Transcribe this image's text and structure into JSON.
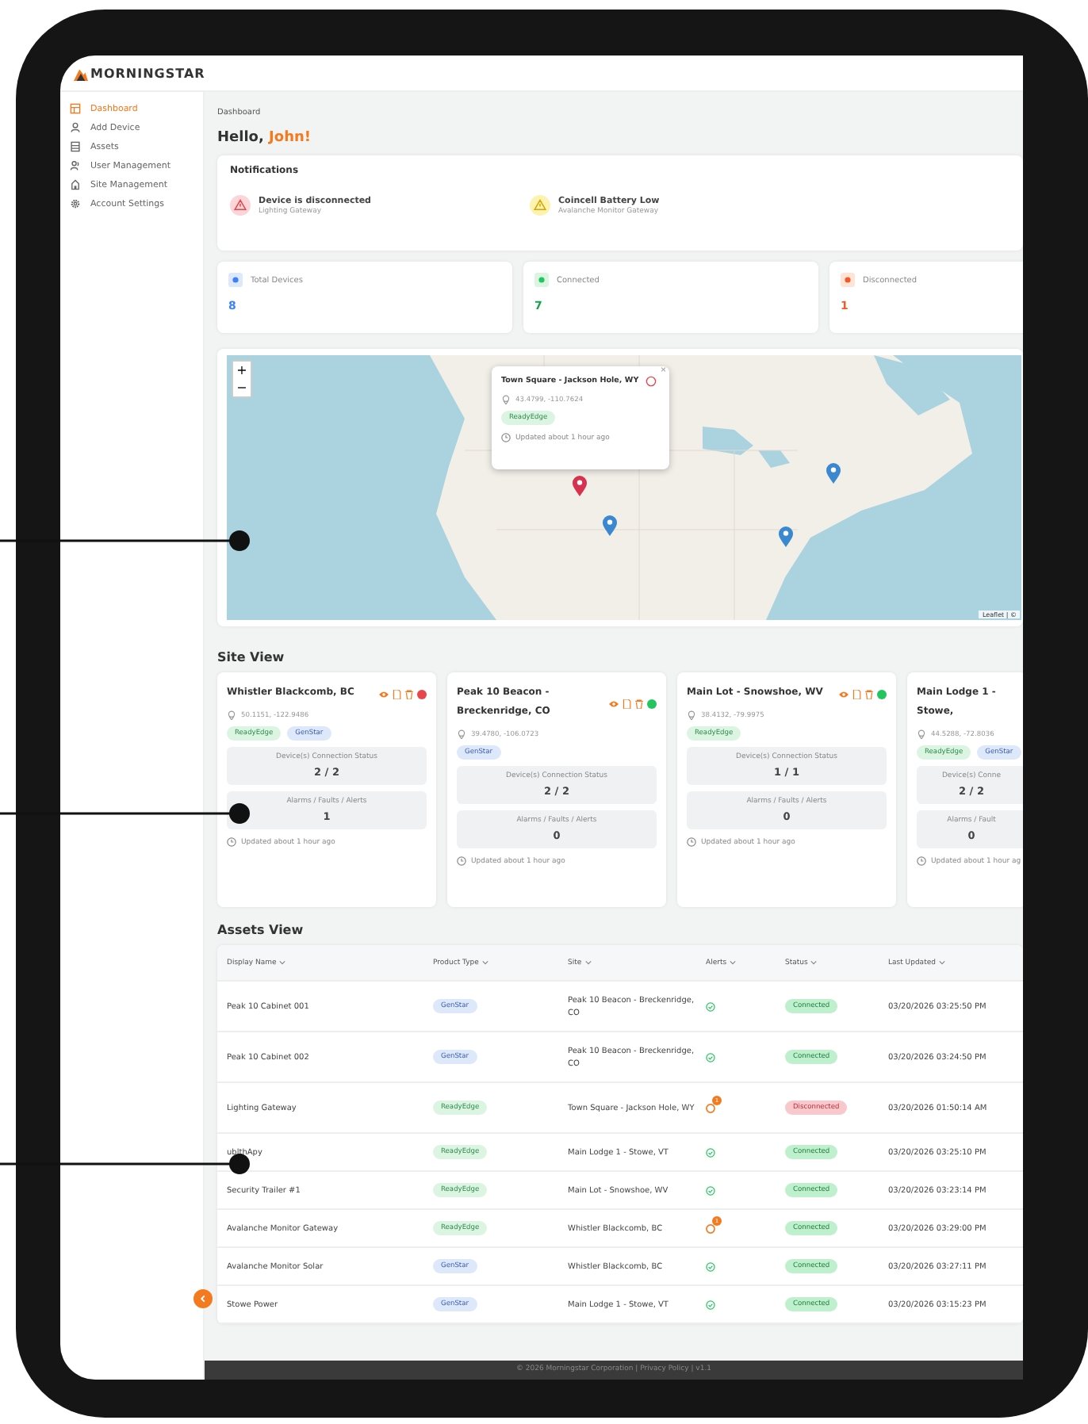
{
  "brand": {
    "name": "MORNINGSTAR"
  },
  "sidebar": {
    "items": [
      {
        "label": "Dashboard",
        "kind": "dashboard",
        "selected": true
      },
      {
        "label": "Add Device",
        "kind": "user",
        "selected": false
      },
      {
        "label": "Assets",
        "kind": "assets",
        "selected": false
      },
      {
        "label": "User Management",
        "kind": "users",
        "selected": false
      },
      {
        "label": "Site Management",
        "kind": "site",
        "selected": false
      },
      {
        "label": "Account Settings",
        "kind": "gear",
        "selected": false
      }
    ]
  },
  "breadcrumb": "Dashboard",
  "greeting": {
    "text": "Hello,",
    "name": "John!"
  },
  "notifications": {
    "title": "Notifications",
    "items": [
      {
        "kind": "error",
        "title": "Device is disconnected",
        "subtitle": "Lighting Gateway"
      },
      {
        "kind": "warning",
        "title": "Coincell Battery Low",
        "subtitle": "Avalanche Monitor Gateway"
      }
    ]
  },
  "stats": [
    {
      "kind": "total",
      "label": "Total Devices",
      "value": "8"
    },
    {
      "kind": "connected",
      "label": "Connected",
      "value": "7"
    },
    {
      "kind": "disconnected",
      "label": "Disconnected",
      "value": "1"
    }
  ],
  "map": {
    "zoom_in": "+",
    "zoom_out": "−",
    "attribution": "Leaflet | ©",
    "popup": {
      "title": "Town Square - Jackson Hole, WY",
      "coords": "43.4799, -110.7624",
      "tags": [
        {
          "kind": "readyedge",
          "label": "ReadyEdge"
        }
      ],
      "updated": "Updated about 1 hour ago",
      "close": "×"
    }
  },
  "site_view": {
    "title": "Site View",
    "sites": [
      {
        "name": "Whistler Blackcomb, BC",
        "coords": "50.1151, -122.9486",
        "color": "#e8464b",
        "tags": [
          {
            "kind": "readyedge",
            "label": "ReadyEdge"
          },
          {
            "kind": "genstar",
            "label": "GenStar"
          }
        ],
        "conn_label": "Device(s) Connection Status",
        "conn": "2 / 2",
        "alarm_label": "Alarms / Faults / Alerts",
        "alarms": "1",
        "updated": "Updated about 1 hour ago"
      },
      {
        "name": "Peak 10 Beacon - Breckenridge, CO",
        "coords": "39.4780, -106.0723",
        "color": "#22c55e",
        "tags": [
          {
            "kind": "genstar",
            "label": "GenStar"
          }
        ],
        "conn_label": "Device(s) Connection Status",
        "conn": "2 / 2",
        "alarm_label": "Alarms / Faults / Alerts",
        "alarms": "0",
        "updated": "Updated about 1 hour ago"
      },
      {
        "name": "Main Lot - Snowshoe, WV",
        "coords": "38.4132, -79.9975",
        "color": "#22c55e",
        "tags": [
          {
            "kind": "readyedge",
            "label": "ReadyEdge"
          }
        ],
        "conn_label": "Device(s) Connection Status",
        "conn": "1 / 1",
        "alarm_label": "Alarms / Faults / Alerts",
        "alarms": "0",
        "updated": "Updated about 1 hour ago"
      },
      {
        "name": "Main Lodge 1 - Stowe,",
        "coords": "44.5288, -72.8036",
        "tags": [
          {
            "kind": "readyedge",
            "label": "ReadyEdge"
          },
          {
            "kind": "genstar",
            "label": "GenStar"
          }
        ],
        "conn_label": "Device(s) Conne",
        "conn": "2 / 2",
        "alarm_label": "Alarms / Fault",
        "alarms": "0",
        "updated": "Updated about 1 hour ag"
      }
    ]
  },
  "assets_view": {
    "title": "Assets View",
    "columns": [
      "Display Name",
      "Product Type",
      "Site",
      "Alerts",
      "Status",
      "Last Updated"
    ],
    "rows": [
      {
        "name": "Peak 10 Cabinet 001",
        "type": {
          "kind": "genstar",
          "label": "GenStar"
        },
        "site": "Peak 10 Beacon - Breckenridge, CO",
        "alert": {
          "kind": "ok"
        },
        "status": {
          "kind": "connected",
          "label": "Connected"
        },
        "updated": "03/20/2026 03:25:50 PM"
      },
      {
        "name": "Peak 10 Cabinet 002",
        "type": {
          "kind": "genstar",
          "label": "GenStar"
        },
        "site": "Peak 10 Beacon - Breckenridge, CO",
        "alert": {
          "kind": "ok"
        },
        "status": {
          "kind": "connected",
          "label": "Connected"
        },
        "updated": "03/20/2026 03:24:50 PM"
      },
      {
        "name": "Lighting Gateway",
        "type": {
          "kind": "readyedge",
          "label": "ReadyEdge"
        },
        "site": "Town Square - Jackson Hole, WY",
        "alert": {
          "kind": "alert",
          "count": "1"
        },
        "status": {
          "kind": "disconnected",
          "label": "Disconnected"
        },
        "updated": "03/20/2026 01:50:14 AM"
      },
      {
        "name": "ublthApy",
        "type": {
          "kind": "readyedge",
          "label": "ReadyEdge"
        },
        "site": "Main Lodge 1 - Stowe, VT",
        "alert": {
          "kind": "ok"
        },
        "status": {
          "kind": "connected",
          "label": "Connected"
        },
        "updated": "03/20/2026 03:25:10 PM"
      },
      {
        "name": "Security Trailer #1",
        "type": {
          "kind": "readyedge",
          "label": "ReadyEdge"
        },
        "site": "Main Lot - Snowshoe, WV",
        "alert": {
          "kind": "ok"
        },
        "status": {
          "kind": "connected",
          "label": "Connected"
        },
        "updated": "03/20/2026 03:23:14 PM"
      },
      {
        "name": "Avalanche Monitor Gateway",
        "type": {
          "kind": "readyedge",
          "label": "ReadyEdge"
        },
        "site": "Whistler Blackcomb, BC",
        "alert": {
          "kind": "alert",
          "count": "1"
        },
        "status": {
          "kind": "connected",
          "label": "Connected"
        },
        "updated": "03/20/2026 03:29:00 PM"
      },
      {
        "name": "Avalanche Monitor Solar",
        "type": {
          "kind": "genstar",
          "label": "GenStar"
        },
        "site": "Whistler Blackcomb, BC",
        "alert": {
          "kind": "ok"
        },
        "status": {
          "kind": "connected",
          "label": "Connected"
        },
        "updated": "03/20/2026 03:27:11 PM"
      },
      {
        "name": "Stowe Power",
        "type": {
          "kind": "genstar",
          "label": "GenStar"
        },
        "site": "Main Lodge 1 - Stowe, VT",
        "alert": {
          "kind": "ok"
        },
        "status": {
          "kind": "connected",
          "label": "Connected"
        },
        "updated": "03/20/2026 03:15:23 PM"
      }
    ]
  },
  "footer": "© 2026 Morningstar Corporation | Privacy Policy | v1.1"
}
